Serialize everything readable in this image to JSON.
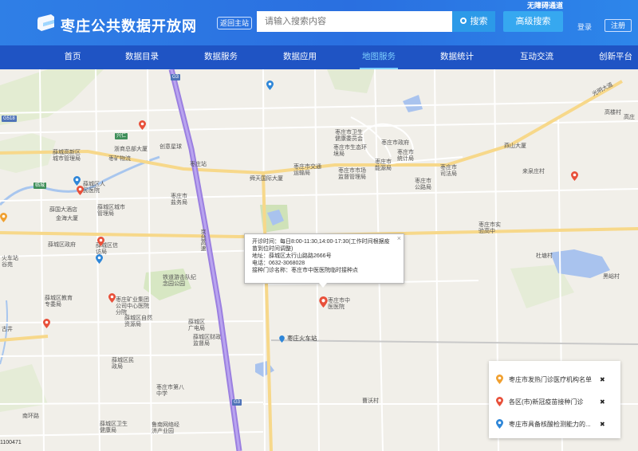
{
  "header": {
    "site_title": "枣庄公共数据开放网",
    "back_label": "返回主站",
    "search_placeholder": "请输入搜索内容",
    "search_label": "搜索",
    "advanced_search_label": "高级搜索",
    "accessibility_label": "无障碍通道",
    "login_label": "登录",
    "register_label": "注册"
  },
  "nav": {
    "items": [
      {
        "label": "首页"
      },
      {
        "label": "数据目录"
      },
      {
        "label": "数据服务"
      },
      {
        "label": "数据应用"
      },
      {
        "label": "地图服务",
        "active": true
      },
      {
        "label": "数据统计"
      },
      {
        "label": "互动交流"
      },
      {
        "label": "创新平台"
      }
    ]
  },
  "popup": {
    "line1": "开诊时间：每日8:00-11:30,14:00-17:30(工作时间根据疫",
    "line2": "苗到位时间调整)",
    "line3": "地址：薛城区太行山路路2666号",
    "line4": "电话：0632-3068028",
    "line5": "接种门诊名称：枣庄市中医医院临时接种点"
  },
  "legend": {
    "items": [
      {
        "label": "枣庄市发热门诊医疗机构名单",
        "color": "#f0a030"
      },
      {
        "label": "各区(市)新冠疫苗接种门诊",
        "color": "#e8503a"
      },
      {
        "label": "枣庄市具备核酸检测能力的...",
        "color": "#2e86d8"
      }
    ],
    "close_glyph": "✖"
  },
  "map": {
    "roads": {
      "g3_a": "G3",
      "g3_b": "G3",
      "g518": "G518",
      "xingren": "兴仁",
      "lincheng": "临城",
      "jingtai": "京台高速",
      "guangming": "光明大道"
    },
    "labels": [
      {
        "text": "枣庄市卫生健康委员会"
      },
      {
        "text": "枣庄市政府"
      },
      {
        "text": "枣庄市生态环境局"
      },
      {
        "text": "枣庄市统计局"
      },
      {
        "text": "枣庄市交通运输局"
      },
      {
        "text": "枣庄市市场监督管理局"
      },
      {
        "text": "枣庄市能源局"
      },
      {
        "text": "枣庄市司法局"
      },
      {
        "text": "枣庄市公路局"
      },
      {
        "text": "枣庄市盐务局"
      },
      {
        "text": "枣庄市实验高中"
      },
      {
        "text": "薛城高新区城市管理局"
      },
      {
        "text": "薛城区人民医院"
      },
      {
        "text": "薛城区城市管理局"
      },
      {
        "text": "薛城区政府"
      },
      {
        "text": "薛城区信访局"
      },
      {
        "text": "枣庄矿业集团公司中心医院分院"
      },
      {
        "text": "薛城区自然资源局"
      },
      {
        "text": "薛城区广电局"
      },
      {
        "text": "薛城区财政监督局"
      },
      {
        "text": "薛城区民政局"
      },
      {
        "text": "枣庄市第八中学"
      },
      {
        "text": "薛城区卫生健康局"
      },
      {
        "text": "枣庄市中医医院"
      },
      {
        "text": "枣庄火车站"
      },
      {
        "text": "铁道游击队纪念园公园"
      },
      {
        "text": "浙商总部大厦"
      },
      {
        "text": "创意星球"
      },
      {
        "text": "枣矿物流"
      },
      {
        "text": "薛国大酒店"
      },
      {
        "text": "金海大厦"
      },
      {
        "text": "舜天国际大厦"
      },
      {
        "text": "枣庄站"
      },
      {
        "text": "燕山大厦"
      },
      {
        "text": "来泉庄村"
      },
      {
        "text": "高楼村"
      },
      {
        "text": "高庄"
      },
      {
        "text": "杜塘村"
      },
      {
        "text": "黑峪村"
      },
      {
        "text": "曹沃村"
      },
      {
        "text": "鲁南网络经济产业园"
      },
      {
        "text": "薛城区教育专委局"
      },
      {
        "text": "古井"
      },
      {
        "text": "南环路"
      },
      {
        "text": "火车站"
      },
      {
        "text": "谷苑"
      }
    ],
    "scale_text": "1100471"
  }
}
